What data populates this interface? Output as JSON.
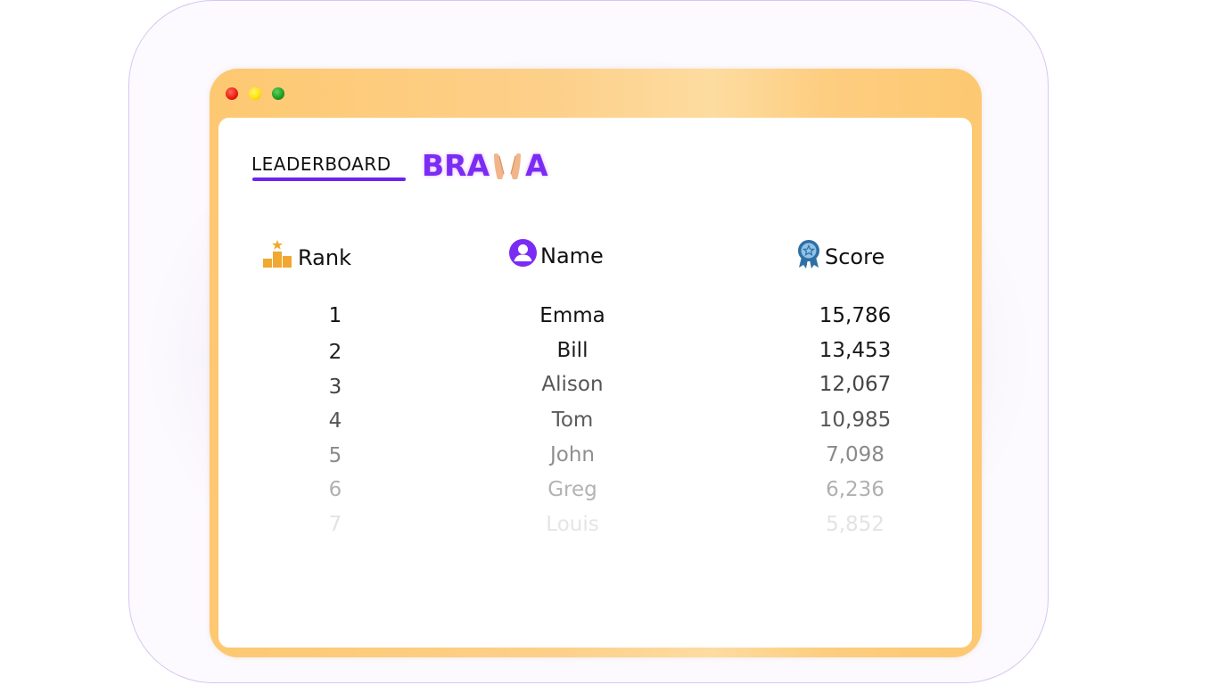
{
  "title": "LEADERBOARD",
  "brand": {
    "left_text": "BRA",
    "right_text": "A",
    "icon": "clapping-hands-icon",
    "color": "#7a2cf5"
  },
  "window": {
    "controls": [
      "close-dot",
      "minimize-dot",
      "maximize-dot"
    ]
  },
  "columns": {
    "rank": {
      "label": "Rank",
      "icon": "podium-icon"
    },
    "name": {
      "label": "Name",
      "icon": "user-avatar-icon"
    },
    "score": {
      "label": "Score",
      "icon": "award-ribbon-icon"
    }
  },
  "rows": [
    {
      "rank": "1",
      "name": "Emma",
      "score": "15,786"
    },
    {
      "rank": "2",
      "name": "Bill",
      "score": "13,453"
    },
    {
      "rank": "3",
      "name": "Alison",
      "score": "12,067"
    },
    {
      "rank": "4",
      "name": "Tom",
      "score": "10,985"
    },
    {
      "rank": "5",
      "name": "John",
      "score": "7,098"
    },
    {
      "rank": "6",
      "name": "Greg",
      "score": "6,236"
    },
    {
      "rank": "7",
      "name": "Louis",
      "score": "5,852"
    }
  ],
  "colors": {
    "accent": "#6b23f0",
    "window_frame": "#fdc871",
    "podium": "#f0a830",
    "ribbon": "#2f6fa3"
  }
}
